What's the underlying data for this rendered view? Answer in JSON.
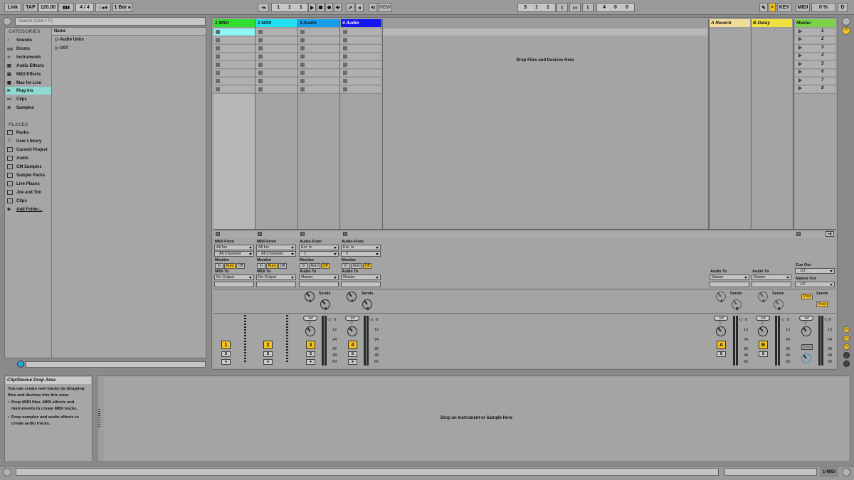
{
  "transport": {
    "link": "Link",
    "tap": "TAP",
    "tempo": "120.00",
    "sig_num": "4",
    "sig_den": "4",
    "quant": "1 Bar",
    "pos1": "1",
    "pos2": "1",
    "pos3": "1",
    "new": "NEW",
    "loop1": "3",
    "loop2": "1",
    "loop3": "1",
    "len1": "4",
    "len2": "0",
    "len3": "0",
    "key": "KEY",
    "midi": "MIDI",
    "cpu": "0 %",
    "d": "D"
  },
  "browser": {
    "search_placeholder": "Search (Cmd + F)",
    "categories_header": "CATEGORIES",
    "categories": [
      {
        "label": "Sounds",
        "icon": "sounds-icon"
      },
      {
        "label": "Drums",
        "icon": "drums-icon"
      },
      {
        "label": "Instruments",
        "icon": "instruments-icon"
      },
      {
        "label": "Audio Effects",
        "icon": "audio-effects-icon"
      },
      {
        "label": "MIDI Effects",
        "icon": "midi-effects-icon"
      },
      {
        "label": "Max for Live",
        "icon": "max-for-live-icon"
      },
      {
        "label": "Plug-ins",
        "icon": "plugins-icon"
      },
      {
        "label": "Clips",
        "icon": "clips-icon"
      },
      {
        "label": "Samples",
        "icon": "samples-icon"
      }
    ],
    "places_header": "PLACES",
    "places": [
      {
        "label": "Packs"
      },
      {
        "label": "User Library"
      },
      {
        "label": "Current Project"
      },
      {
        "label": "Audio"
      },
      {
        "label": "CM Samples"
      },
      {
        "label": "Sample Packs"
      },
      {
        "label": "Live Places"
      },
      {
        "label": "Joe and Tim"
      },
      {
        "label": "Clips"
      },
      {
        "label": "Add Folder..."
      }
    ],
    "name_header": "Name",
    "items": [
      "Audio Units",
      "VST"
    ]
  },
  "tracks": [
    {
      "name": "1 MIDI",
      "color": "#2fe02f",
      "number": "1"
    },
    {
      "name": "2 MIDI",
      "color": "#20e0f2",
      "number": "2"
    },
    {
      "name": "3 Audio",
      "color": "#1a9ee8",
      "number": "3"
    },
    {
      "name": "4 Audio",
      "color": "#1515f0",
      "number": "4"
    }
  ],
  "returns": [
    {
      "name": "A Reverb",
      "color": "#f1dc9a",
      "letter": "A"
    },
    {
      "name": "B Delay",
      "color": "#f0e040",
      "letter": "B"
    }
  ],
  "master": {
    "name": "Master",
    "color": "#7bd34a",
    "cue_out": "Cue Out",
    "cue_val": "1/2",
    "master_out": "Master Out",
    "master_val": "1/2",
    "post": "Post",
    "solo": "Solo"
  },
  "scenes": [
    "1",
    "2",
    "3",
    "4",
    "5",
    "6",
    "7",
    "8"
  ],
  "drop_files": "Drop Files and Devices Here",
  "io": {
    "midi_from": "MIDI From",
    "audio_from": "Audio From",
    "all_ins": "All Ins",
    "ext_in": "Ext. In",
    "all_channels": "All Channels",
    "ch1": "1",
    "ch2": "2",
    "monitor": "Monitor",
    "mon_in": "In",
    "mon_auto": "Auto",
    "mon_off": "Off",
    "midi_to": "MIDI To",
    "audio_to": "Audio To",
    "no_output": "No Output",
    "master": "Master",
    "sends": "Sends",
    "send_a": "A",
    "send_b": "B",
    "inf": "-Inf",
    "solo": "S",
    "ticks": [
      "0",
      "12",
      "24",
      "36",
      "48",
      "60"
    ]
  },
  "info": {
    "title": "Clip/Device Drop Area",
    "line1": "You can create new tracks by dropping files and devices into this area:",
    "bullet1": "Drop MIDI files, MIDI effects and instruments to create MIDI tracks.",
    "bullet2": "Drop samples and audio effects to create audio tracks."
  },
  "device_drop": "Drop an Instrument or Sample Here",
  "status": {
    "track": "1-MIDI"
  }
}
